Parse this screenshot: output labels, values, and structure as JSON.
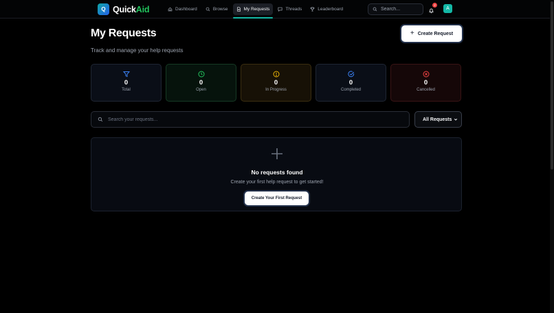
{
  "app": {
    "logo_letter": "Q",
    "name_part1": "Quick",
    "name_part2": "Aid"
  },
  "nav": {
    "items": [
      {
        "label": "Dashboard",
        "icon": "home-icon"
      },
      {
        "label": "Browse",
        "icon": "search-icon"
      },
      {
        "label": "My Requests",
        "icon": "document-icon",
        "active": true
      },
      {
        "label": "Threads",
        "icon": "chat-icon"
      },
      {
        "label": "Leaderboard",
        "icon": "trophy-icon"
      }
    ],
    "search_placeholder": "Search...",
    "notification_count": "2",
    "avatar_initial": "A"
  },
  "header": {
    "title": "My Requests",
    "subtitle": "Track and manage your help requests",
    "create_label": "Create Request"
  },
  "stats": [
    {
      "value": "0",
      "label": "Total",
      "icon": "filter-icon",
      "color": "#3b82f6"
    },
    {
      "value": "0",
      "label": "Open",
      "icon": "clock-icon",
      "color": "#22c55e"
    },
    {
      "value": "0",
      "label": "In Progress",
      "icon": "alert-circle-icon",
      "color": "#eab308"
    },
    {
      "value": "0",
      "label": "Completed",
      "icon": "check-circle-icon",
      "color": "#3b82f6"
    },
    {
      "value": "0",
      "label": "Cancelled",
      "icon": "x-circle-icon",
      "color": "#ef4444"
    }
  ],
  "filters": {
    "search_placeholder": "Search your requests...",
    "selected": "All Requests"
  },
  "empty_state": {
    "title": "No requests found",
    "description": "Create your first help request to get started!",
    "button_label": "Create Your First Request"
  }
}
